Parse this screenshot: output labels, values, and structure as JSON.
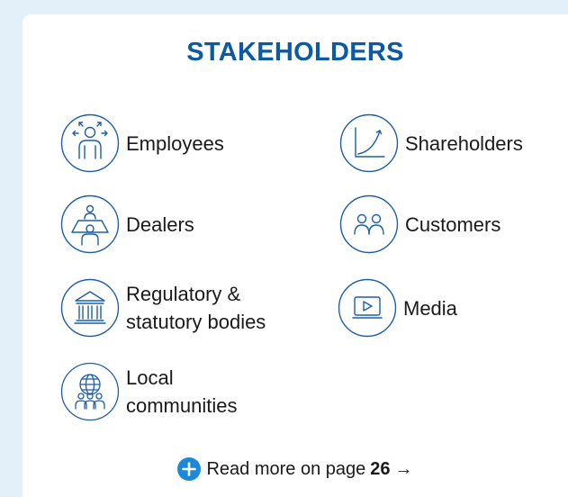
{
  "title": "STAKEHOLDERS",
  "accent_color": "#0a5aa6",
  "icon_color": "#1d5ea8",
  "stakeholders": [
    {
      "icon": "employees-icon",
      "lines": [
        "Employees"
      ]
    },
    {
      "icon": "shareholders-icon",
      "lines": [
        "Shareholders"
      ]
    },
    {
      "icon": "dealers-icon",
      "lines": [
        "Dealers"
      ]
    },
    {
      "icon": "customers-icon",
      "lines": [
        "Customers"
      ]
    },
    {
      "icon": "regulatory-bodies-icon",
      "lines": [
        "Regulatory &",
        "statutory bodies"
      ]
    },
    {
      "icon": "media-icon",
      "lines": [
        "Media"
      ]
    },
    {
      "icon": "local-communities-icon",
      "lines": [
        "Local",
        "communities"
      ]
    }
  ],
  "footer": {
    "icon": "plus-icon",
    "text": "Read more on page",
    "page": "26",
    "arrow": "→"
  }
}
